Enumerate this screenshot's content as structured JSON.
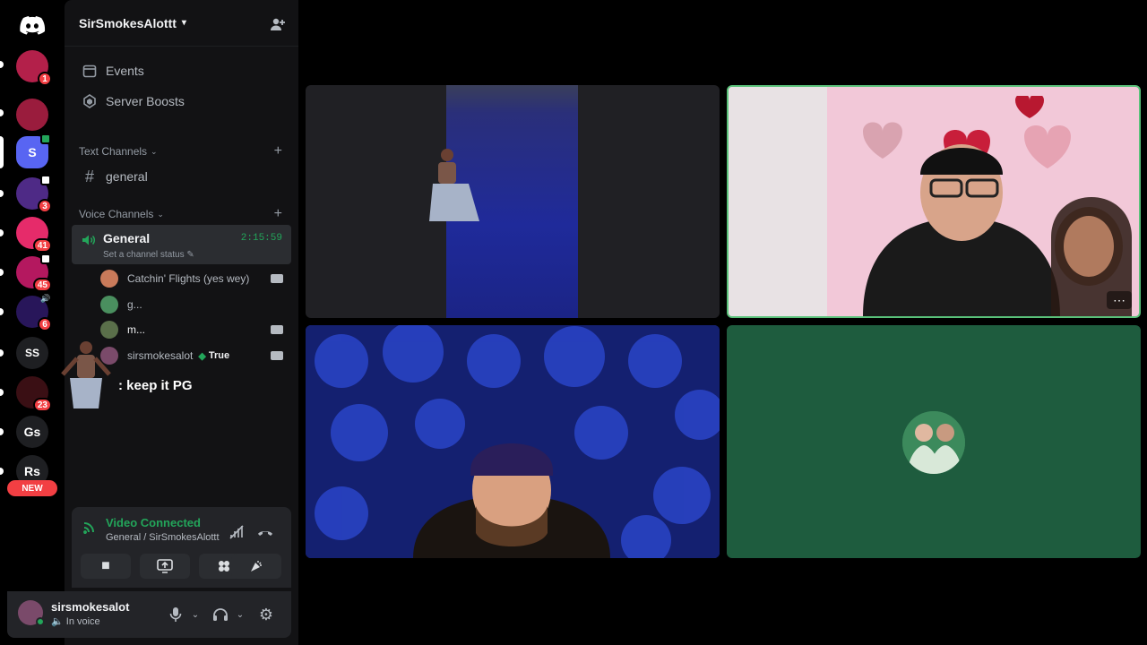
{
  "server": {
    "name": "SirSmokesAlottt"
  },
  "rail": {
    "servers": [
      {
        "badge": "1",
        "color": "#b3204a"
      },
      {
        "badge": "",
        "color": "#9a1c3d"
      },
      {
        "initial": "S",
        "color": "#5865f2"
      },
      {
        "badge": "3",
        "color": "#4e2a86"
      },
      {
        "badge": "41",
        "color": "#e62b6a"
      },
      {
        "badge": "45",
        "color": "#b4185f"
      },
      {
        "badge": "6",
        "color": "#28165a"
      },
      {
        "initial": "SS",
        "color": "#1e1f22"
      },
      {
        "badge": "23",
        "color": "#3a0f14"
      },
      {
        "initial": "Gs",
        "color": "#1e1f22"
      },
      {
        "initial": "Rs",
        "color": "#1e1f22"
      }
    ],
    "new_label": "NEW"
  },
  "sidebar": {
    "events_label": "Events",
    "boosts_label": "Server Boosts",
    "text_category": "Text Channels",
    "text_channel": "general",
    "voice_category": "Voice Channels",
    "voice_channel": {
      "name": "General",
      "timer": "2:15:59",
      "status": "Set a channel status"
    },
    "members": [
      {
        "name": "Catchin' Flights (yes wey)",
        "color": "#c97a5a"
      },
      {
        "name": "g...",
        "color": "#4a8f5f"
      },
      {
        "name": "m...",
        "color": "#5a6f4a"
      },
      {
        "name": "sirsmokesalot",
        "color": "#7a4a6a",
        "tag": "True"
      }
    ]
  },
  "overlay": {
    "chat_text": ": keep it PG"
  },
  "voice_panel": {
    "title": "Video Connected",
    "subtitle": "General / SirSmokesAlottt"
  },
  "user": {
    "name": "sirsmokesalot",
    "status": "In voice"
  },
  "colors": {
    "accent": "#5865f2",
    "online": "#23a55a",
    "danger": "#f23f43",
    "tile_green": "#1e5c3e",
    "tile_blue": "#1a2c8a"
  }
}
